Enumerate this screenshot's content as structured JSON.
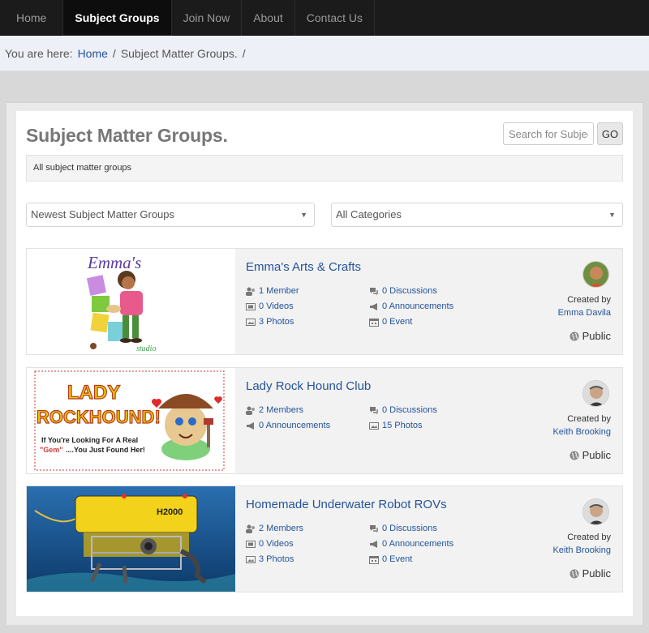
{
  "nav": {
    "items": [
      {
        "label": "Home"
      },
      {
        "label": "Subject Groups"
      },
      {
        "label": "Join Now"
      },
      {
        "label": "About"
      },
      {
        "label": "Contact Us"
      }
    ]
  },
  "breadcrumb": {
    "prefix": "You are here:",
    "home": "Home",
    "sep": "/",
    "current": "Subject Matter Groups.",
    "trail_sep": "/"
  },
  "page": {
    "title": "Subject Matter Groups.",
    "search_placeholder": "Search for Subject",
    "go_label": "GO",
    "description": "All subject matter groups"
  },
  "filters": {
    "sort_selected": "Newest Subject Matter Groups",
    "category_selected": "All Categories"
  },
  "groups": [
    {
      "title": "Emma's Arts & Crafts",
      "stats_left": [
        "1 Member",
        "0 Videos",
        "3 Photos"
      ],
      "stats_right": [
        "0 Discussions",
        "0 Announcements",
        "0 Event"
      ],
      "created_by_label": "Created by",
      "creator": "Emma Davila",
      "privacy": "Public",
      "thumb_text": {
        "top": "Emma's",
        "sub": "studio"
      }
    },
    {
      "title": "Lady Rock Hound Club",
      "stats_left": [
        "2 Members",
        "0 Announcements"
      ],
      "stats_right": [
        "0 Discussions",
        "15 Photos"
      ],
      "created_by_label": "Created by",
      "creator": "Keith Brooking",
      "privacy": "Public",
      "thumb_text": {
        "line1": "LADY",
        "line2": "ROCKHOUND!",
        "line3": "If You're Looking For A Real",
        "gem": "\"Gem\"",
        "line4": "....You Just Found Her!"
      }
    },
    {
      "title": "Homemade Underwater Robot ROVs",
      "stats_left": [
        "2 Members",
        "0 Videos",
        "3 Photos"
      ],
      "stats_right": [
        "0 Discussions",
        "0 Announcements",
        "0 Event"
      ],
      "created_by_label": "Created by",
      "creator": "Keith Brooking",
      "privacy": "Public",
      "thumb_text": {
        "model": "H2000"
      }
    }
  ],
  "colors": {
    "link": "#24539b",
    "nav_bg": "#1b1b1b",
    "card_bg": "#f2f2f2"
  }
}
